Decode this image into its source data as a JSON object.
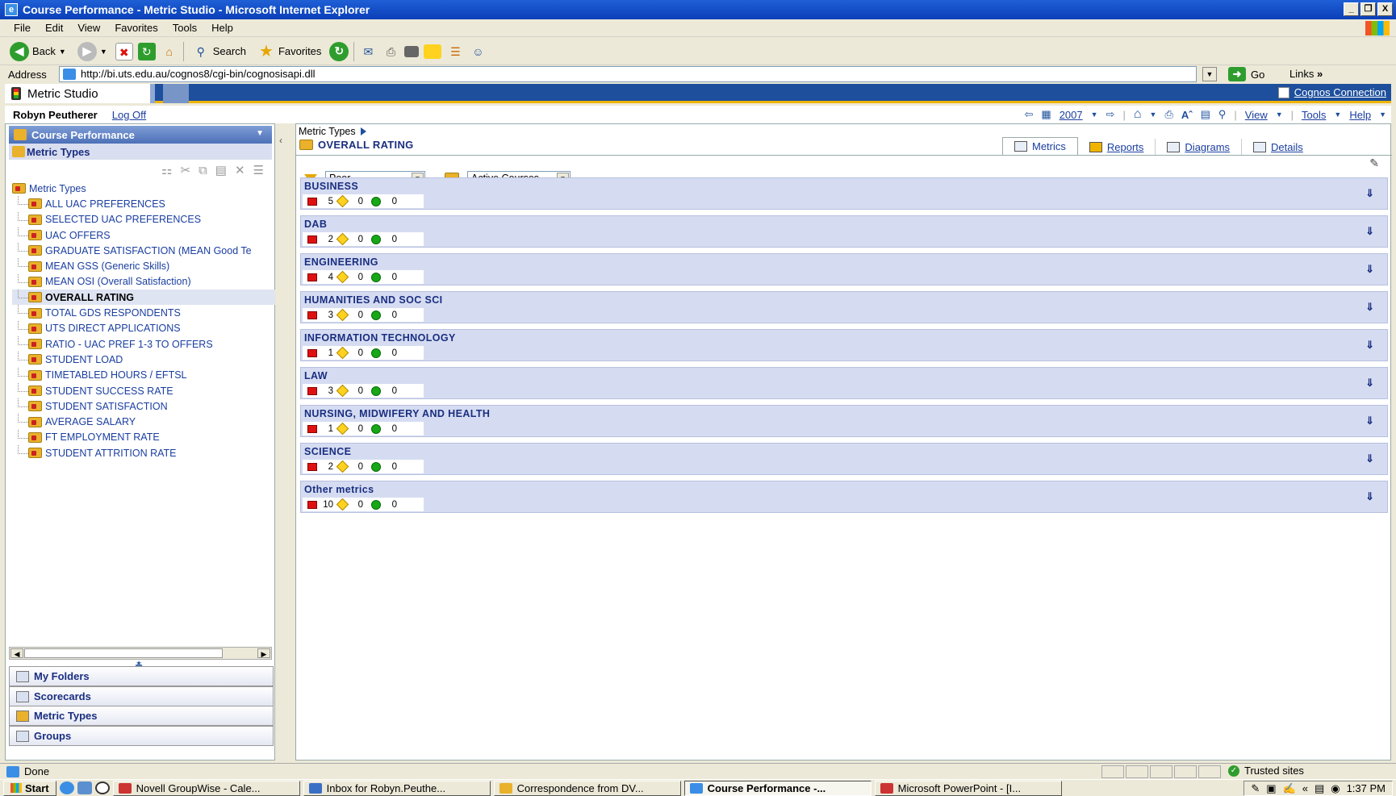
{
  "window": {
    "title": "Course Performance - Metric Studio - Microsoft Internet Explorer",
    "minimize": "_",
    "restore": "❐",
    "close": "X"
  },
  "menu": [
    "File",
    "Edit",
    "View",
    "Favorites",
    "Tools",
    "Help"
  ],
  "toolbar": {
    "back": "Back",
    "search": "Search",
    "favorites": "Favorites"
  },
  "address": {
    "label": "Address",
    "url": "http://bi.uts.edu.au/cognos8/cgi-bin/cognosisapi.dll",
    "go": "Go",
    "links": "Links"
  },
  "studio": {
    "title": "Metric Studio",
    "cognos_connection": "Cognos Connection"
  },
  "user": {
    "name": "Robyn Peutherer",
    "logoff": "Log Off"
  },
  "right_tools": {
    "year": "2007",
    "view": "View",
    "tools": "Tools",
    "help": "Help"
  },
  "left": {
    "scorecard": "Course Performance",
    "section": "Metric Types",
    "tree_root": "Metric Types",
    "items": [
      "ALL UAC PREFERENCES",
      "SELECTED UAC PREFERENCES",
      "UAC OFFERS",
      "GRADUATE SATISFACTION (MEAN Good Te",
      "MEAN GSS (Generic Skills)",
      "MEAN OSI (Overall Satisfaction)",
      "OVERALL RATING",
      "TOTAL GDS RESPONDENTS",
      "UTS DIRECT APPLICATIONS",
      "RATIO - UAC PREF 1-3 TO OFFERS",
      "STUDENT LOAD",
      "TIMETABLED HOURS / EFTSL",
      "STUDENT SUCCESS RATE",
      "STUDENT SATISFACTION",
      "AVERAGE SALARY",
      "FT EMPLOYMENT RATE",
      "STUDENT ATTRITION RATE"
    ],
    "selected_index": 6,
    "nav": [
      "My Folders",
      "Scorecards",
      "Metric Types",
      "Groups"
    ]
  },
  "main": {
    "breadcrumb": "Metric Types",
    "title": "OVERALL RATING",
    "tabs": [
      "Metrics",
      "Reports",
      "Diagrams",
      "Details"
    ],
    "filter_status": "Poor",
    "filter_courses": "Active Courses",
    "groups": [
      {
        "name": "BUSINESS",
        "red": "5",
        "yellow": "0",
        "green": "0"
      },
      {
        "name": "DAB",
        "red": "2",
        "yellow": "0",
        "green": "0"
      },
      {
        "name": "ENGINEERING",
        "red": "4",
        "yellow": "0",
        "green": "0"
      },
      {
        "name": "HUMANITIES AND SOC SCI",
        "red": "3",
        "yellow": "0",
        "green": "0"
      },
      {
        "name": "INFORMATION TECHNOLOGY",
        "red": "1",
        "yellow": "0",
        "green": "0"
      },
      {
        "name": "LAW",
        "red": "3",
        "yellow": "0",
        "green": "0"
      },
      {
        "name": "NURSING, MIDWIFERY AND HEALTH",
        "red": "1",
        "yellow": "0",
        "green": "0"
      },
      {
        "name": "SCIENCE",
        "red": "2",
        "yellow": "0",
        "green": "0"
      },
      {
        "name": "Other metrics",
        "red": "10",
        "yellow": "0",
        "green": "0"
      }
    ]
  },
  "status": {
    "text": "Done",
    "zone": "Trusted sites"
  },
  "taskbar": {
    "start": "Start",
    "tasks": [
      "Novell GroupWise - Cale...",
      "Inbox for Robyn.Peuthe...",
      "Correspondence from DV...",
      "Course Performance -...",
      "Microsoft PowerPoint - [I..."
    ],
    "active_index": 3,
    "clock": "1:37 PM"
  }
}
